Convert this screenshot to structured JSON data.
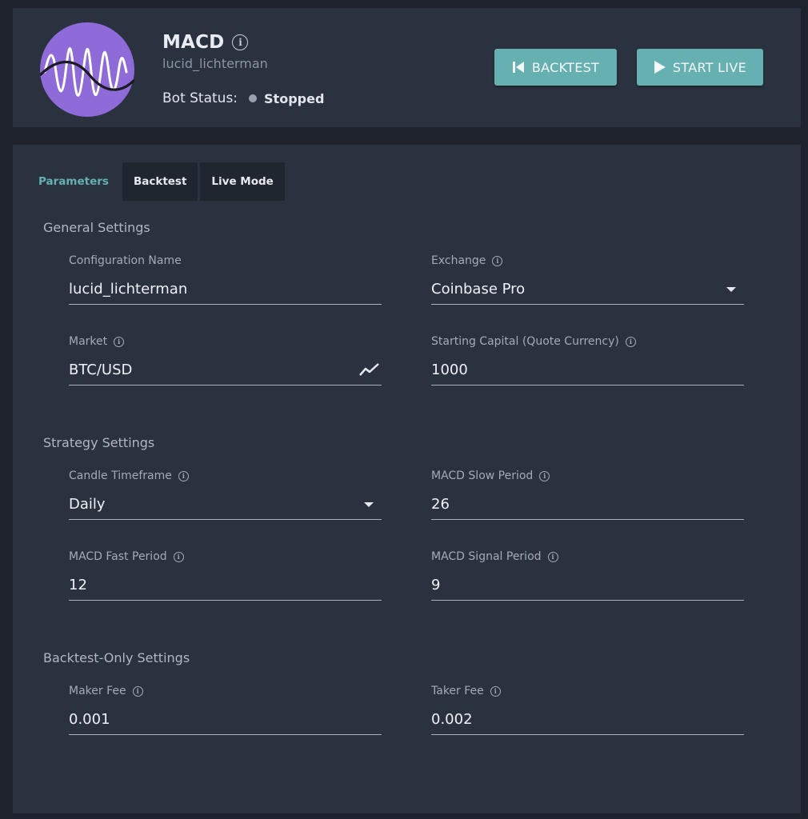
{
  "bot": {
    "name": "MACD",
    "config_name": "lucid_lichterman",
    "status_label": "Bot Status:",
    "status_value": "Stopped"
  },
  "actions": {
    "backtest_label": "BACKTEST",
    "start_live_label": "START LIVE"
  },
  "tabs": [
    {
      "label": "Parameters",
      "active": true
    },
    {
      "label": "Backtest",
      "active": false
    },
    {
      "label": "Live Mode",
      "active": false
    }
  ],
  "sections": {
    "general": {
      "title": "General Settings",
      "configuration_name": {
        "label": "Configuration Name",
        "value": "lucid_lichterman"
      },
      "exchange": {
        "label": "Exchange",
        "value": "Coinbase Pro"
      },
      "market": {
        "label": "Market",
        "value": "BTC/USD"
      },
      "starting_capital": {
        "label": "Starting Capital (Quote Currency)",
        "value": "1000"
      }
    },
    "strategy": {
      "title": "Strategy Settings",
      "candle_timeframe": {
        "label": "Candle Timeframe",
        "value": "Daily"
      },
      "macd_slow": {
        "label": "MACD Slow Period",
        "value": "26"
      },
      "macd_fast": {
        "label": "MACD Fast Period",
        "value": "12"
      },
      "macd_signal": {
        "label": "MACD Signal Period",
        "value": "9"
      }
    },
    "backtest_only": {
      "title": "Backtest-Only Settings",
      "maker_fee": {
        "label": "Maker Fee",
        "value": "0.001"
      },
      "taker_fee": {
        "label": "Taker Fee",
        "value": "0.002"
      }
    }
  },
  "icons": {
    "info": "info-icon",
    "status_dot": "status-dot-icon",
    "backtest": "skip-back-icon",
    "live": "play-icon",
    "market": "trend-chart-icon",
    "dropdown": "caret-down-icon"
  },
  "colors": {
    "accent": "#66b0b1",
    "panel": "#2a3240",
    "background": "#1d222c",
    "avatar": "#8e6bd8"
  }
}
